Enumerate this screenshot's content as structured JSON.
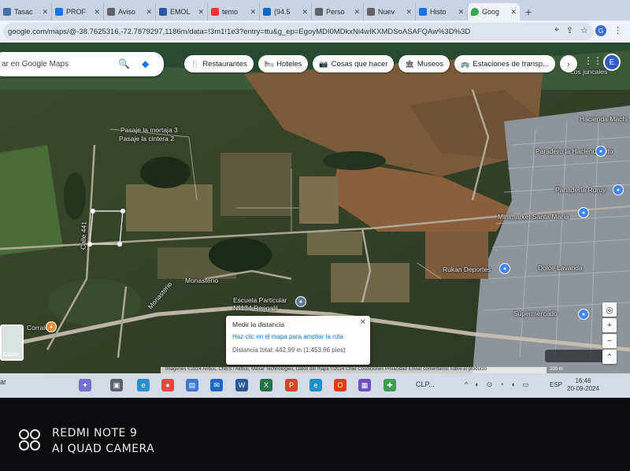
{
  "browser": {
    "tabs": [
      {
        "label": "Tasac",
        "color": "#4a6fa5"
      },
      {
        "label": "PROF",
        "color": "#1a73e8"
      },
      {
        "label": "Aviso",
        "color": "#5f6368"
      },
      {
        "label": "EMOL",
        "color": "#2c57a0"
      },
      {
        "label": "temo",
        "color": "#e53935"
      },
      {
        "label": "(94.5",
        "color": "#1565c0"
      },
      {
        "label": "Perso",
        "color": "#5f6368"
      },
      {
        "label": "Nuev",
        "color": "#5f6368"
      },
      {
        "label": "Histo",
        "color": "#1a73e8"
      },
      {
        "label": "Goog",
        "color": "#34a853",
        "active": true
      }
    ],
    "close_glyph": "✕",
    "new_tab_glyph": "+",
    "url": "google.com/maps/@-38.7625316,-72.7879297,1186m/data=!3m1!1e3?entry=ttu&g_ep=EgoyMDI0MDkxNi4wIKXMDSoASAFQAw%3D%3D",
    "profile_initial": "G"
  },
  "maps": {
    "search_placeholder": "ar en Google Maps",
    "chips": [
      {
        "icon": "🍴",
        "label": "Restaurantes"
      },
      {
        "icon": "🛏",
        "label": "Hoteles"
      },
      {
        "icon": "📷",
        "label": "Cosas que hacer"
      },
      {
        "icon": "🏛",
        "label": "Museos"
      },
      {
        "icon": "🚌",
        "label": "Estaciones de transp..."
      }
    ],
    "more_glyph": "›",
    "account_initial": "E",
    "labels": {
      "los_juncales": "Los juncales",
      "pasaje_mortaja": "Pasaje la mortaja 3",
      "pasaje_cintera": "Pasaje la cintera 2",
      "hacienda_machi": "Hacienda Machi",
      "paradero_hacienda": "Paradero la Hacienda Lito",
      "panaderia_ruruy": "Panadería Ruruy",
      "minimarket": "Minimarket Santa María",
      "rukan": "Rukan Deportes",
      "monasterio": "Monasterio",
      "monasterio2": "Monasterio",
      "escuela": "Escuela Particular N°134 Rengalil",
      "dolce_lavanda": "Dolce Lavanda",
      "supermercado": "Supermercado",
      "calle_441": "Calle 441",
      "corralera": "Corralera"
    },
    "measure": {
      "title": "Medir la distancia",
      "hint": "Haz clic en el mapa para ampliar la ruta",
      "total": "Distancia total: 442,99 m (1.453,66 pies)",
      "close": "✕"
    },
    "controls": {
      "zoom_in": "+",
      "zoom_out": "−",
      "locate": "◎",
      "expand": "⌃"
    },
    "layers_label": "Capas",
    "attribution": "Imágenes ©2024 Airbus, CNES / Airbus, Maxar Technologies, Datos del mapa ©2024   Chile   Condiciones   Privacidad   Enviar comentarios sobre el producto",
    "scale": "200 m"
  },
  "taskbar": {
    "search_text": "ar",
    "weather": "CLP...",
    "lang": "ESP",
    "time": "16:46",
    "date": "20-09-2024"
  },
  "watermark": {
    "line1": "REDMI NOTE 9",
    "line2": "AI QUAD CAMERA"
  }
}
